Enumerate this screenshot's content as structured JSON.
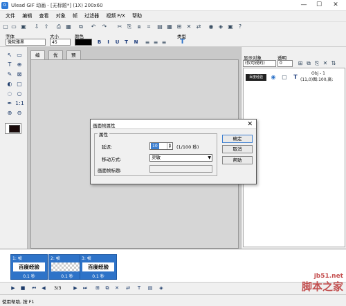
{
  "window": {
    "title": "Ulead GIF 动画 - [无标题*] (1X) 200x60",
    "icon": "app-icon",
    "controls": [
      "—",
      "☐",
      "✕"
    ]
  },
  "menu": {
    "items": [
      "文件",
      "编辑",
      "查看",
      "对象",
      "帧",
      "过滤器",
      "视频 F/X",
      "帮助"
    ]
  },
  "properties_bar": {
    "font_label": "字体",
    "font_value": "微软雅黑",
    "size_label": "大小",
    "size_value": "45",
    "color_label": "颜色",
    "color_value": "#000000",
    "type_label": "类型",
    "format_buttons": [
      "B",
      "I",
      "U",
      "T",
      "N"
    ]
  },
  "editor": {
    "tabs": [
      "编辑",
      "优化",
      "预览"
    ],
    "active_tab": "编辑"
  },
  "object_panel": {
    "display_label": "显示对象",
    "display_value": "(仅可视的)",
    "opacity_label": "透明",
    "opacity_value": "0",
    "object_name": "Obj - 1",
    "object_info": "(11,0)图:100,高:",
    "type_icon": "T"
  },
  "dialog": {
    "title": "画面帧属性",
    "group_label": "属性",
    "delay_label": "延迟:",
    "delay_value": "10",
    "delay_unit": "(1/100 秒)",
    "disposal_label": "移动方式:",
    "disposal_value": "灵敏",
    "frame_title_label": "画面帧标题:",
    "frame_title_value": "",
    "ok_label": "确定",
    "cancel_label": "取消",
    "help_label": "帮助"
  },
  "frames": [
    {
      "label": "1: 帧",
      "text": "百度经验",
      "delay": "0.1 秒"
    },
    {
      "label": "2: 帧",
      "text": "",
      "delay": "0.1 秒"
    },
    {
      "label": "3: 帧",
      "text": "百度经验",
      "delay": "0.1 秒"
    }
  ],
  "playback": {
    "counter": "3/3"
  },
  "status": {
    "text": "使用帮助, 按 F1"
  },
  "watermark": {
    "line1": "jb51.net",
    "line2": "脚本之家"
  },
  "colors": {
    "frame_accent": "#2e73c8",
    "selection": "#3c7fd0"
  }
}
